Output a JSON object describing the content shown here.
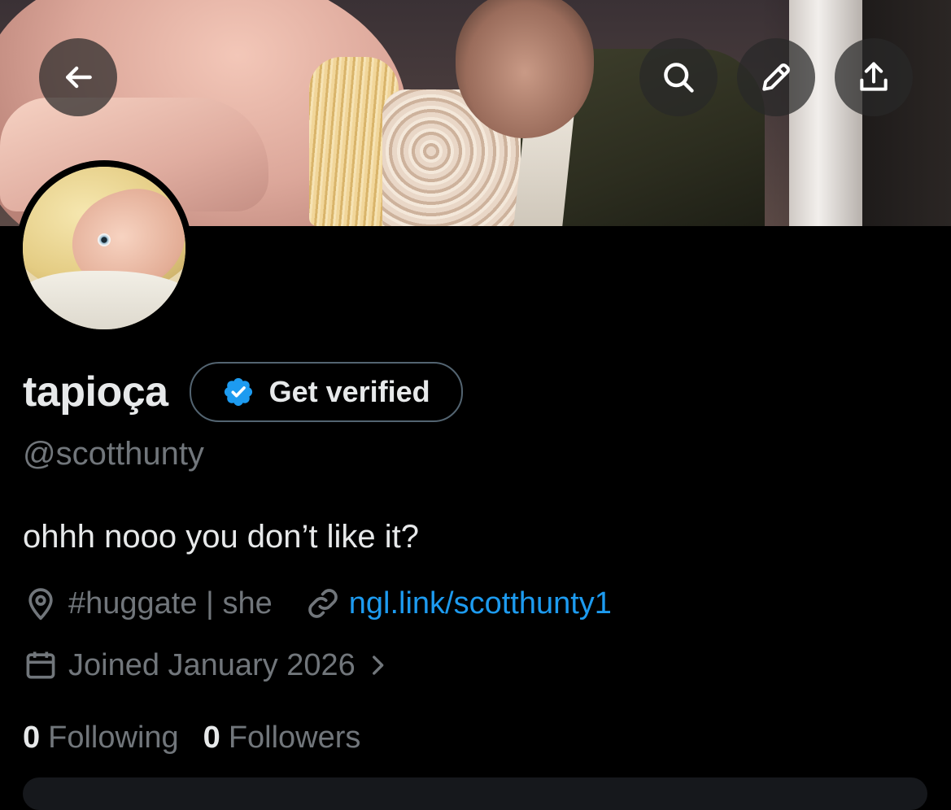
{
  "profile": {
    "name": "tapioça",
    "handle": "@scotthunty",
    "bio": "ohhh nooo you don’t like it?",
    "location": "#huggate | she",
    "website": "ngl.link/scotthunty1",
    "joined": "Joined January 2026",
    "following_count": "0",
    "following_label": "Following",
    "followers_count": "0",
    "followers_label": "Followers"
  },
  "verify_button": {
    "label": "Get verified"
  },
  "header_buttons": {
    "back": "arrow-left-icon",
    "search": "search-icon",
    "edit": "pencil-icon",
    "share": "share-icon"
  },
  "colors": {
    "background": "#000000",
    "text_primary": "#e7e9ea",
    "text_secondary": "#71767b",
    "link": "#1d9bf0",
    "verified_badge": "#1d9bf0"
  }
}
